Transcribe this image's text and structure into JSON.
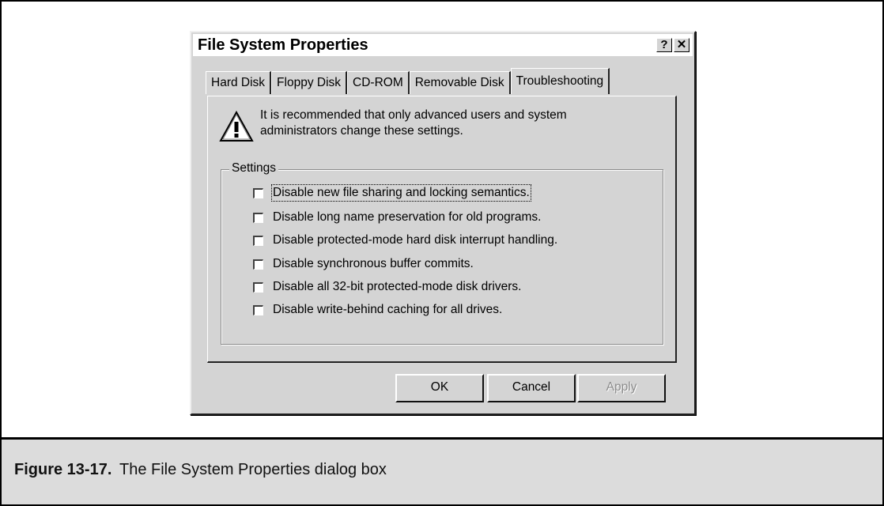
{
  "dialog": {
    "title": "File System Properties",
    "help_button": "?",
    "close_button": "✕",
    "tabs": [
      "Hard Disk",
      "Floppy Disk",
      "CD-ROM",
      "Removable Disk",
      "Troubleshooting"
    ],
    "active_tab": "Troubleshooting",
    "warning_icon": "warning-icon",
    "warning_text": "It is recommended that only advanced users and system administrators change these settings.",
    "settings_label": "Settings",
    "options": [
      "Disable new file sharing and locking semantics.",
      "Disable long name preservation for old programs.",
      "Disable protected-mode hard disk interrupt handling.",
      "Disable synchronous buffer commits.",
      "Disable all 32-bit protected-mode disk drivers.",
      "Disable write-behind caching for all drives."
    ],
    "buttons": {
      "ok": "OK",
      "cancel": "Cancel",
      "apply": "Apply"
    }
  },
  "caption": {
    "number": "Figure 13-17.",
    "text": "The File System Properties dialog box"
  }
}
